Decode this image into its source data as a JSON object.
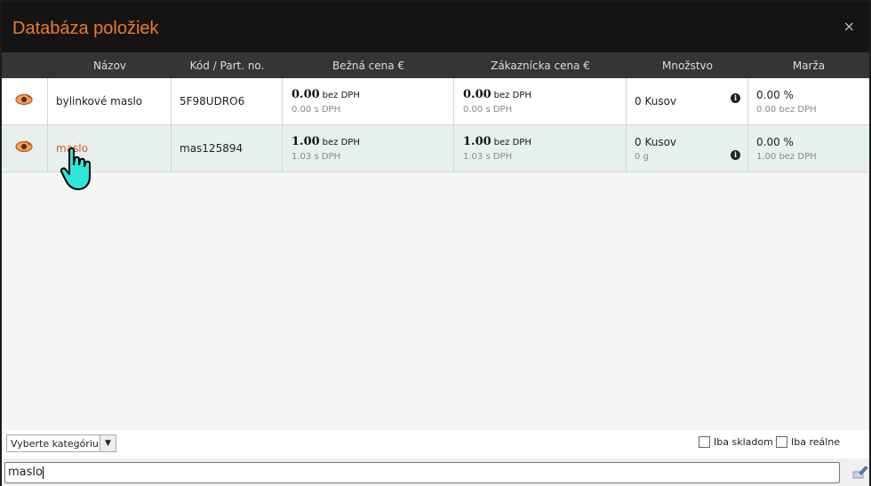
{
  "dialog": {
    "title": "Databáza položiek",
    "close": "×"
  },
  "columns": [
    "Názov",
    "Kód / Part. no.",
    "Bežná cena €",
    "Zákaznícka cena €",
    "Množstvo",
    "Marža"
  ],
  "rows": [
    {
      "name": "bylinkové maslo",
      "code": "5F98UDRO6",
      "price": "0.00",
      "price_suffix": "bez DPH",
      "price_vat": "0.00 s DPH",
      "cust_price": "0.00",
      "cust_suffix": "bez DPH",
      "cust_vat": "0.00 s DPH",
      "qty": "0 Kusov",
      "qty_sub": "",
      "margin": "0.00 %",
      "margin_sub": "0.00 bez DPH"
    },
    {
      "name": "maslo",
      "code": "mas125894",
      "price": "1.00",
      "price_suffix": "bez DPH",
      "price_vat": "1.03 s DPH",
      "cust_price": "1.00",
      "cust_suffix": "bez DPH",
      "cust_vat": "1.03 s DPH",
      "qty": "0 Kusov",
      "qty_sub": "0 g",
      "margin": "0.00 %",
      "margin_sub": "1.00 bez DPH"
    }
  ],
  "filters": {
    "category_placeholder": "Vyberte kategóriu",
    "only_stock": "Iba skladom",
    "only_real": "Iba reálne"
  },
  "search": {
    "value": "maslo"
  },
  "colors": {
    "accent": "#f07a23",
    "link": "#e05a20",
    "titlebar": "#141414",
    "header": "#353535"
  }
}
